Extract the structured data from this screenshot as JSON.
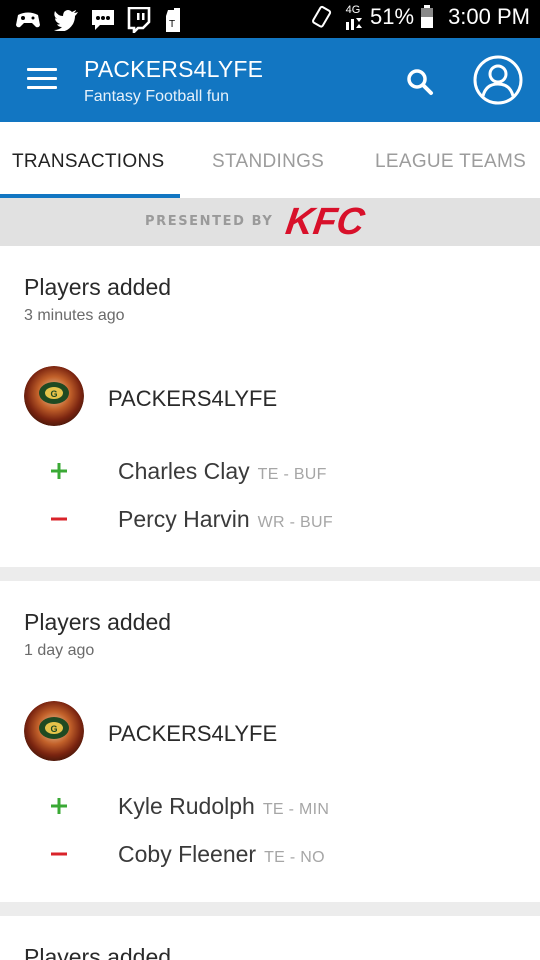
{
  "status_bar": {
    "battery": "51%",
    "time": "3:00 PM",
    "network": "4G",
    "icons": [
      "gamepad-icon",
      "twitter-icon",
      "message-icon",
      "twitch-icon",
      "notification-icon",
      "vibrate-icon",
      "signal-icon",
      "battery-icon"
    ]
  },
  "app_bar": {
    "title": "PACKERS4LYFE",
    "subtitle": "Fantasy Football fun",
    "accent_color": "#1276c2"
  },
  "tabs": [
    {
      "label": "TRANSACTIONS",
      "active": true
    },
    {
      "label": "STANDINGS",
      "active": false
    },
    {
      "label": "LEAGUE TEAMS",
      "active": false
    }
  ],
  "sponsor": {
    "presented_by": "PRESENTED BY",
    "brand": "KFC"
  },
  "transactions": [
    {
      "title": "Players added",
      "time": "3 minutes ago",
      "team": "PACKERS4LYFE",
      "moves": [
        {
          "type": "add",
          "player": "Charles Clay",
          "position": "TE - BUF"
        },
        {
          "type": "drop",
          "player": "Percy Harvin",
          "position": "WR - BUF"
        }
      ]
    },
    {
      "title": "Players added",
      "time": "1 day ago",
      "team": "PACKERS4LYFE",
      "moves": [
        {
          "type": "add",
          "player": "Kyle Rudolph",
          "position": "TE - MIN"
        },
        {
          "type": "drop",
          "player": "Coby Fleener",
          "position": "TE - NO"
        }
      ]
    },
    {
      "title": "Players added"
    }
  ],
  "colors": {
    "add": "#3aa935",
    "drop": "#d9232a"
  }
}
